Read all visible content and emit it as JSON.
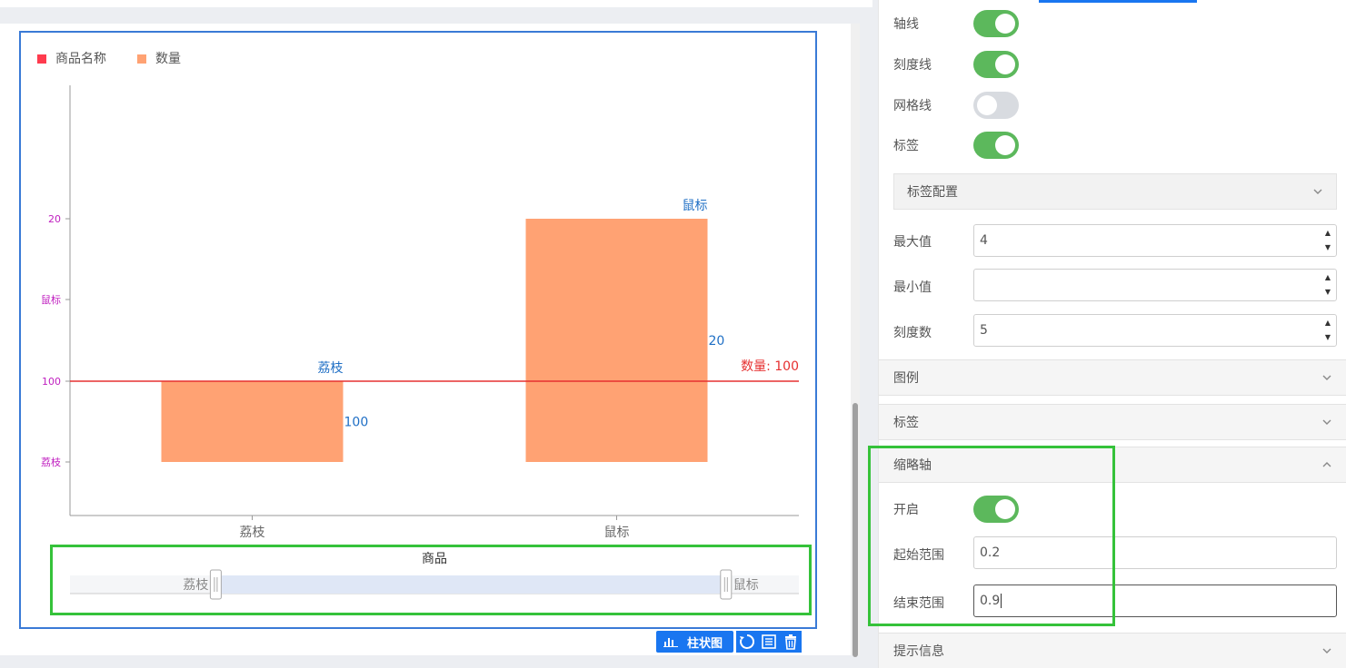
{
  "chart_data": {
    "type": "bar",
    "legend": [
      {
        "name": "商品名称",
        "color": "#ff3b4e"
      },
      {
        "name": "数量",
        "color": "#ffa273"
      }
    ],
    "legend_position": "top-left",
    "categories": [
      "荔枝",
      "鼠标"
    ],
    "series": [
      {
        "name": "数量",
        "values": [
          100,
          20
        ],
        "color": "#ffa273",
        "labels": [
          "100",
          "20"
        ]
      },
      {
        "name": "商品名称",
        "values": [
          "荔枝",
          "鼠标"
        ],
        "color": "#ff3b4e",
        "labels": [
          "荔枝",
          "鼠标"
        ]
      }
    ],
    "y_ticks": [
      "荔枝",
      "100",
      "鼠标",
      "20"
    ],
    "y_tick_color": "#c020c0",
    "mark_line": {
      "label": "数量: 100",
      "value": 100,
      "color": "#e63030"
    },
    "label_color": "#1f6fc5",
    "grid": false,
    "datazoom": {
      "title": "商品",
      "start_label": "荔枝",
      "end_label": "鼠标",
      "start": 0.2,
      "end": 0.9
    }
  },
  "toolbar": {
    "chart_type_label": "柱状图"
  },
  "panel": {
    "toggles": [
      {
        "label": "轴线",
        "on": true
      },
      {
        "label": "刻度线",
        "on": true
      },
      {
        "label": "网格线",
        "on": false
      },
      {
        "label": "标签",
        "on": true
      }
    ],
    "label_config_title": "标签配置",
    "max_label": "最大值",
    "max_value": "4",
    "min_label": "最小值",
    "min_value": "",
    "ticks_label": "刻度数",
    "ticks_value": "5",
    "sections": {
      "legend": "图例",
      "label": "标签",
      "datazoom": "缩略轴",
      "tooltip": "提示信息"
    },
    "datazoom": {
      "enable_label": "开启",
      "enable_on": true,
      "start_label": "起始范围",
      "start_value": "0.2",
      "end_label": "结束范围",
      "end_value": "0.9"
    }
  }
}
